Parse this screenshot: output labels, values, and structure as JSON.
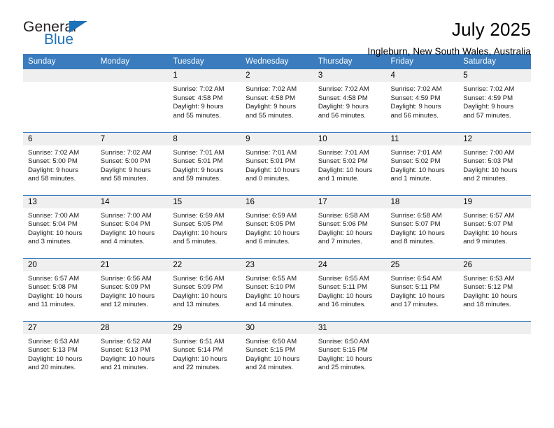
{
  "brand": {
    "name_top": "General",
    "name_bottom": "Blue",
    "triangle_color": "#1d71b8"
  },
  "header": {
    "title": "July 2025",
    "subtitle": "Ingleburn, New South Wales, Australia"
  },
  "theme": {
    "header_blue": "#3a7cbe",
    "daynum_gray": "#efefef"
  },
  "weekdays": [
    "Sunday",
    "Monday",
    "Tuesday",
    "Wednesday",
    "Thursday",
    "Friday",
    "Saturday"
  ],
  "labels": {
    "sunrise_prefix": "Sunrise:",
    "sunset_prefix": "Sunset:",
    "daylight_prefix": "Daylight:"
  },
  "weeks": [
    [
      {
        "day": "",
        "empty": true
      },
      {
        "day": "",
        "empty": true
      },
      {
        "day": "1",
        "sunrise": "Sunrise: 7:02 AM",
        "sunset": "Sunset: 4:58 PM",
        "daylight_1": "Daylight: 9 hours",
        "daylight_2": "and 55 minutes."
      },
      {
        "day": "2",
        "sunrise": "Sunrise: 7:02 AM",
        "sunset": "Sunset: 4:58 PM",
        "daylight_1": "Daylight: 9 hours",
        "daylight_2": "and 55 minutes."
      },
      {
        "day": "3",
        "sunrise": "Sunrise: 7:02 AM",
        "sunset": "Sunset: 4:58 PM",
        "daylight_1": "Daylight: 9 hours",
        "daylight_2": "and 56 minutes."
      },
      {
        "day": "4",
        "sunrise": "Sunrise: 7:02 AM",
        "sunset": "Sunset: 4:59 PM",
        "daylight_1": "Daylight: 9 hours",
        "daylight_2": "and 56 minutes."
      },
      {
        "day": "5",
        "sunrise": "Sunrise: 7:02 AM",
        "sunset": "Sunset: 4:59 PM",
        "daylight_1": "Daylight: 9 hours",
        "daylight_2": "and 57 minutes."
      }
    ],
    [
      {
        "day": "6",
        "sunrise": "Sunrise: 7:02 AM",
        "sunset": "Sunset: 5:00 PM",
        "daylight_1": "Daylight: 9 hours",
        "daylight_2": "and 58 minutes."
      },
      {
        "day": "7",
        "sunrise": "Sunrise: 7:02 AM",
        "sunset": "Sunset: 5:00 PM",
        "daylight_1": "Daylight: 9 hours",
        "daylight_2": "and 58 minutes."
      },
      {
        "day": "8",
        "sunrise": "Sunrise: 7:01 AM",
        "sunset": "Sunset: 5:01 PM",
        "daylight_1": "Daylight: 9 hours",
        "daylight_2": "and 59 minutes."
      },
      {
        "day": "9",
        "sunrise": "Sunrise: 7:01 AM",
        "sunset": "Sunset: 5:01 PM",
        "daylight_1": "Daylight: 10 hours",
        "daylight_2": "and 0 minutes."
      },
      {
        "day": "10",
        "sunrise": "Sunrise: 7:01 AM",
        "sunset": "Sunset: 5:02 PM",
        "daylight_1": "Daylight: 10 hours",
        "daylight_2": "and 1 minute."
      },
      {
        "day": "11",
        "sunrise": "Sunrise: 7:01 AM",
        "sunset": "Sunset: 5:02 PM",
        "daylight_1": "Daylight: 10 hours",
        "daylight_2": "and 1 minute."
      },
      {
        "day": "12",
        "sunrise": "Sunrise: 7:00 AM",
        "sunset": "Sunset: 5:03 PM",
        "daylight_1": "Daylight: 10 hours",
        "daylight_2": "and 2 minutes."
      }
    ],
    [
      {
        "day": "13",
        "sunrise": "Sunrise: 7:00 AM",
        "sunset": "Sunset: 5:04 PM",
        "daylight_1": "Daylight: 10 hours",
        "daylight_2": "and 3 minutes."
      },
      {
        "day": "14",
        "sunrise": "Sunrise: 7:00 AM",
        "sunset": "Sunset: 5:04 PM",
        "daylight_1": "Daylight: 10 hours",
        "daylight_2": "and 4 minutes."
      },
      {
        "day": "15",
        "sunrise": "Sunrise: 6:59 AM",
        "sunset": "Sunset: 5:05 PM",
        "daylight_1": "Daylight: 10 hours",
        "daylight_2": "and 5 minutes."
      },
      {
        "day": "16",
        "sunrise": "Sunrise: 6:59 AM",
        "sunset": "Sunset: 5:05 PM",
        "daylight_1": "Daylight: 10 hours",
        "daylight_2": "and 6 minutes."
      },
      {
        "day": "17",
        "sunrise": "Sunrise: 6:58 AM",
        "sunset": "Sunset: 5:06 PM",
        "daylight_1": "Daylight: 10 hours",
        "daylight_2": "and 7 minutes."
      },
      {
        "day": "18",
        "sunrise": "Sunrise: 6:58 AM",
        "sunset": "Sunset: 5:07 PM",
        "daylight_1": "Daylight: 10 hours",
        "daylight_2": "and 8 minutes."
      },
      {
        "day": "19",
        "sunrise": "Sunrise: 6:57 AM",
        "sunset": "Sunset: 5:07 PM",
        "daylight_1": "Daylight: 10 hours",
        "daylight_2": "and 9 minutes."
      }
    ],
    [
      {
        "day": "20",
        "sunrise": "Sunrise: 6:57 AM",
        "sunset": "Sunset: 5:08 PM",
        "daylight_1": "Daylight: 10 hours",
        "daylight_2": "and 11 minutes."
      },
      {
        "day": "21",
        "sunrise": "Sunrise: 6:56 AM",
        "sunset": "Sunset: 5:09 PM",
        "daylight_1": "Daylight: 10 hours",
        "daylight_2": "and 12 minutes."
      },
      {
        "day": "22",
        "sunrise": "Sunrise: 6:56 AM",
        "sunset": "Sunset: 5:09 PM",
        "daylight_1": "Daylight: 10 hours",
        "daylight_2": "and 13 minutes."
      },
      {
        "day": "23",
        "sunrise": "Sunrise: 6:55 AM",
        "sunset": "Sunset: 5:10 PM",
        "daylight_1": "Daylight: 10 hours",
        "daylight_2": "and 14 minutes."
      },
      {
        "day": "24",
        "sunrise": "Sunrise: 6:55 AM",
        "sunset": "Sunset: 5:11 PM",
        "daylight_1": "Daylight: 10 hours",
        "daylight_2": "and 16 minutes."
      },
      {
        "day": "25",
        "sunrise": "Sunrise: 6:54 AM",
        "sunset": "Sunset: 5:11 PM",
        "daylight_1": "Daylight: 10 hours",
        "daylight_2": "and 17 minutes."
      },
      {
        "day": "26",
        "sunrise": "Sunrise: 6:53 AM",
        "sunset": "Sunset: 5:12 PM",
        "daylight_1": "Daylight: 10 hours",
        "daylight_2": "and 18 minutes."
      }
    ],
    [
      {
        "day": "27",
        "sunrise": "Sunrise: 6:53 AM",
        "sunset": "Sunset: 5:13 PM",
        "daylight_1": "Daylight: 10 hours",
        "daylight_2": "and 20 minutes."
      },
      {
        "day": "28",
        "sunrise": "Sunrise: 6:52 AM",
        "sunset": "Sunset: 5:13 PM",
        "daylight_1": "Daylight: 10 hours",
        "daylight_2": "and 21 minutes."
      },
      {
        "day": "29",
        "sunrise": "Sunrise: 6:51 AM",
        "sunset": "Sunset: 5:14 PM",
        "daylight_1": "Daylight: 10 hours",
        "daylight_2": "and 22 minutes."
      },
      {
        "day": "30",
        "sunrise": "Sunrise: 6:50 AM",
        "sunset": "Sunset: 5:15 PM",
        "daylight_1": "Daylight: 10 hours",
        "daylight_2": "and 24 minutes."
      },
      {
        "day": "31",
        "sunrise": "Sunrise: 6:50 AM",
        "sunset": "Sunset: 5:15 PM",
        "daylight_1": "Daylight: 10 hours",
        "daylight_2": "and 25 minutes."
      },
      {
        "day": "",
        "empty": true
      },
      {
        "day": "",
        "empty": true
      }
    ]
  ]
}
